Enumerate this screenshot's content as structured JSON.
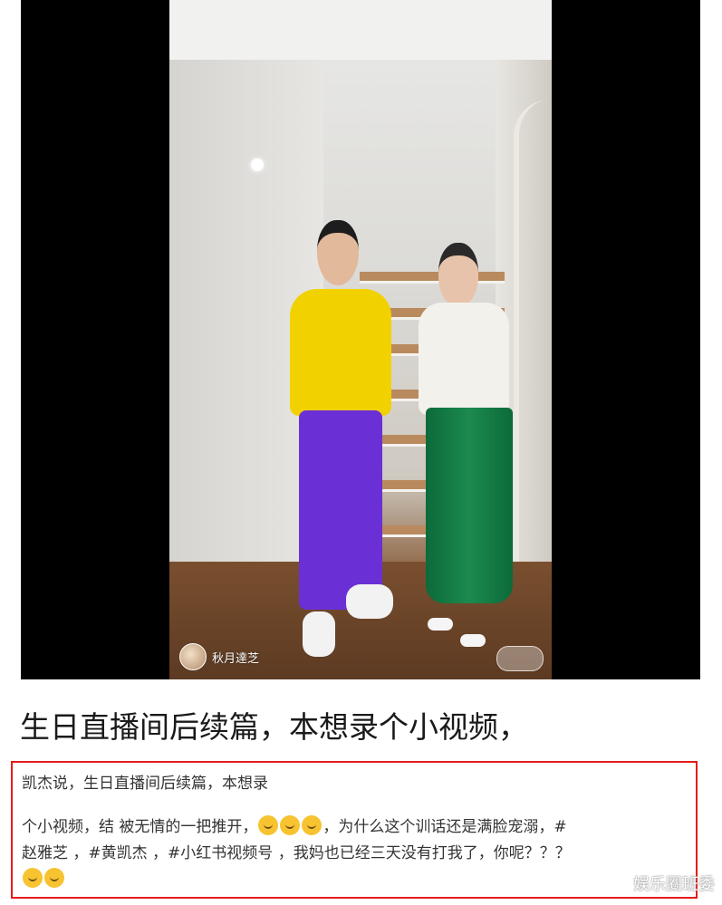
{
  "video": {
    "author_name": "秋月達芝"
  },
  "headline": "生日直播间后续篇，本想录个小视频，",
  "description": {
    "line1": "凯杰说，生日直播间后续篇，本想录",
    "line2_a": "个小视频，结 被无情的一把推开，",
    "line2_b": "，为什么这个训话还是满脸宠溺，#",
    "line3": "赵雅芝 ，#黄凯杰 ，#小红书视频号 ，我妈也已经三天没有打我了，你呢？？？",
    "emoji_name": "laughing-face-emoji"
  },
  "watermark": "娱乐圈班委",
  "colors": {
    "highlight_border": "#e61c1c"
  }
}
